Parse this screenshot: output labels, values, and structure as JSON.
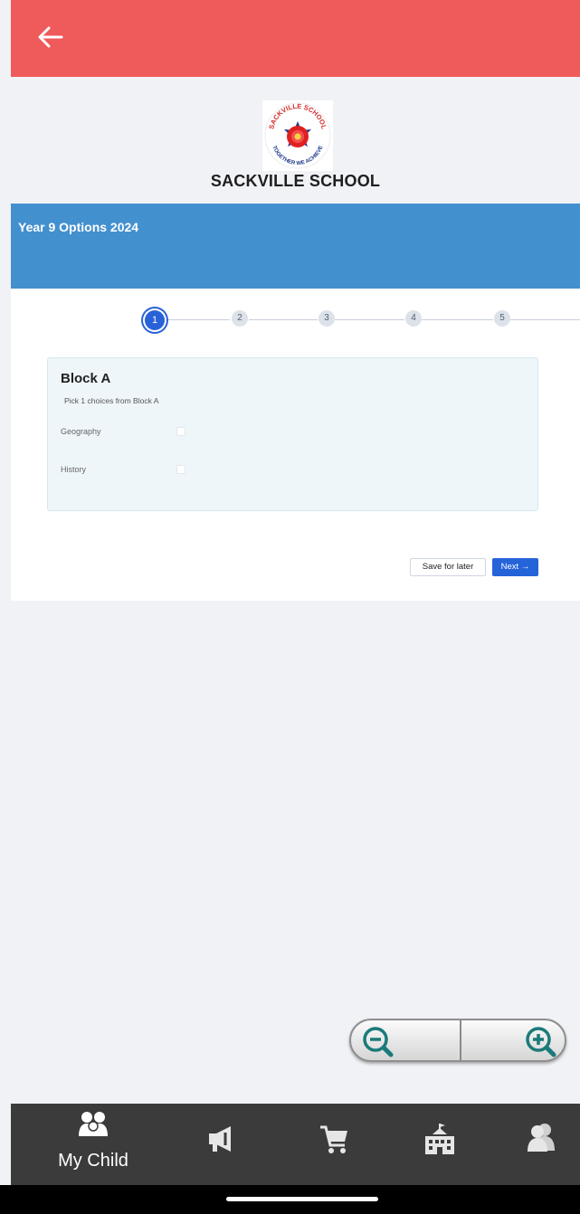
{
  "school": {
    "name": "SACKVILLE SCHOOL"
  },
  "banner": {
    "title": "Year 9 Options 2024"
  },
  "stepper": {
    "steps": [
      "1",
      "2",
      "3",
      "4",
      "5"
    ],
    "active": 1
  },
  "block": {
    "title": "Block A",
    "subtitle": "Pick 1 choices from Block A",
    "options": [
      {
        "label": "Geography",
        "checked": false
      },
      {
        "label": "History",
        "checked": false
      }
    ]
  },
  "actions": {
    "save_label": "Save for later",
    "next_label": "Next →"
  },
  "tabbar": {
    "items": [
      {
        "label": "My Child",
        "icon": "children-icon"
      },
      {
        "label": "",
        "icon": "megaphone-icon"
      },
      {
        "label": "",
        "icon": "cart-icon"
      },
      {
        "label": "",
        "icon": "school-building-icon"
      },
      {
        "label": "",
        "icon": "contacts-icon"
      }
    ]
  },
  "colors": {
    "topbar": "#ef5a5a",
    "banner": "#4390cf",
    "primary": "#2563d9",
    "tabbar": "#3b3b3b"
  }
}
